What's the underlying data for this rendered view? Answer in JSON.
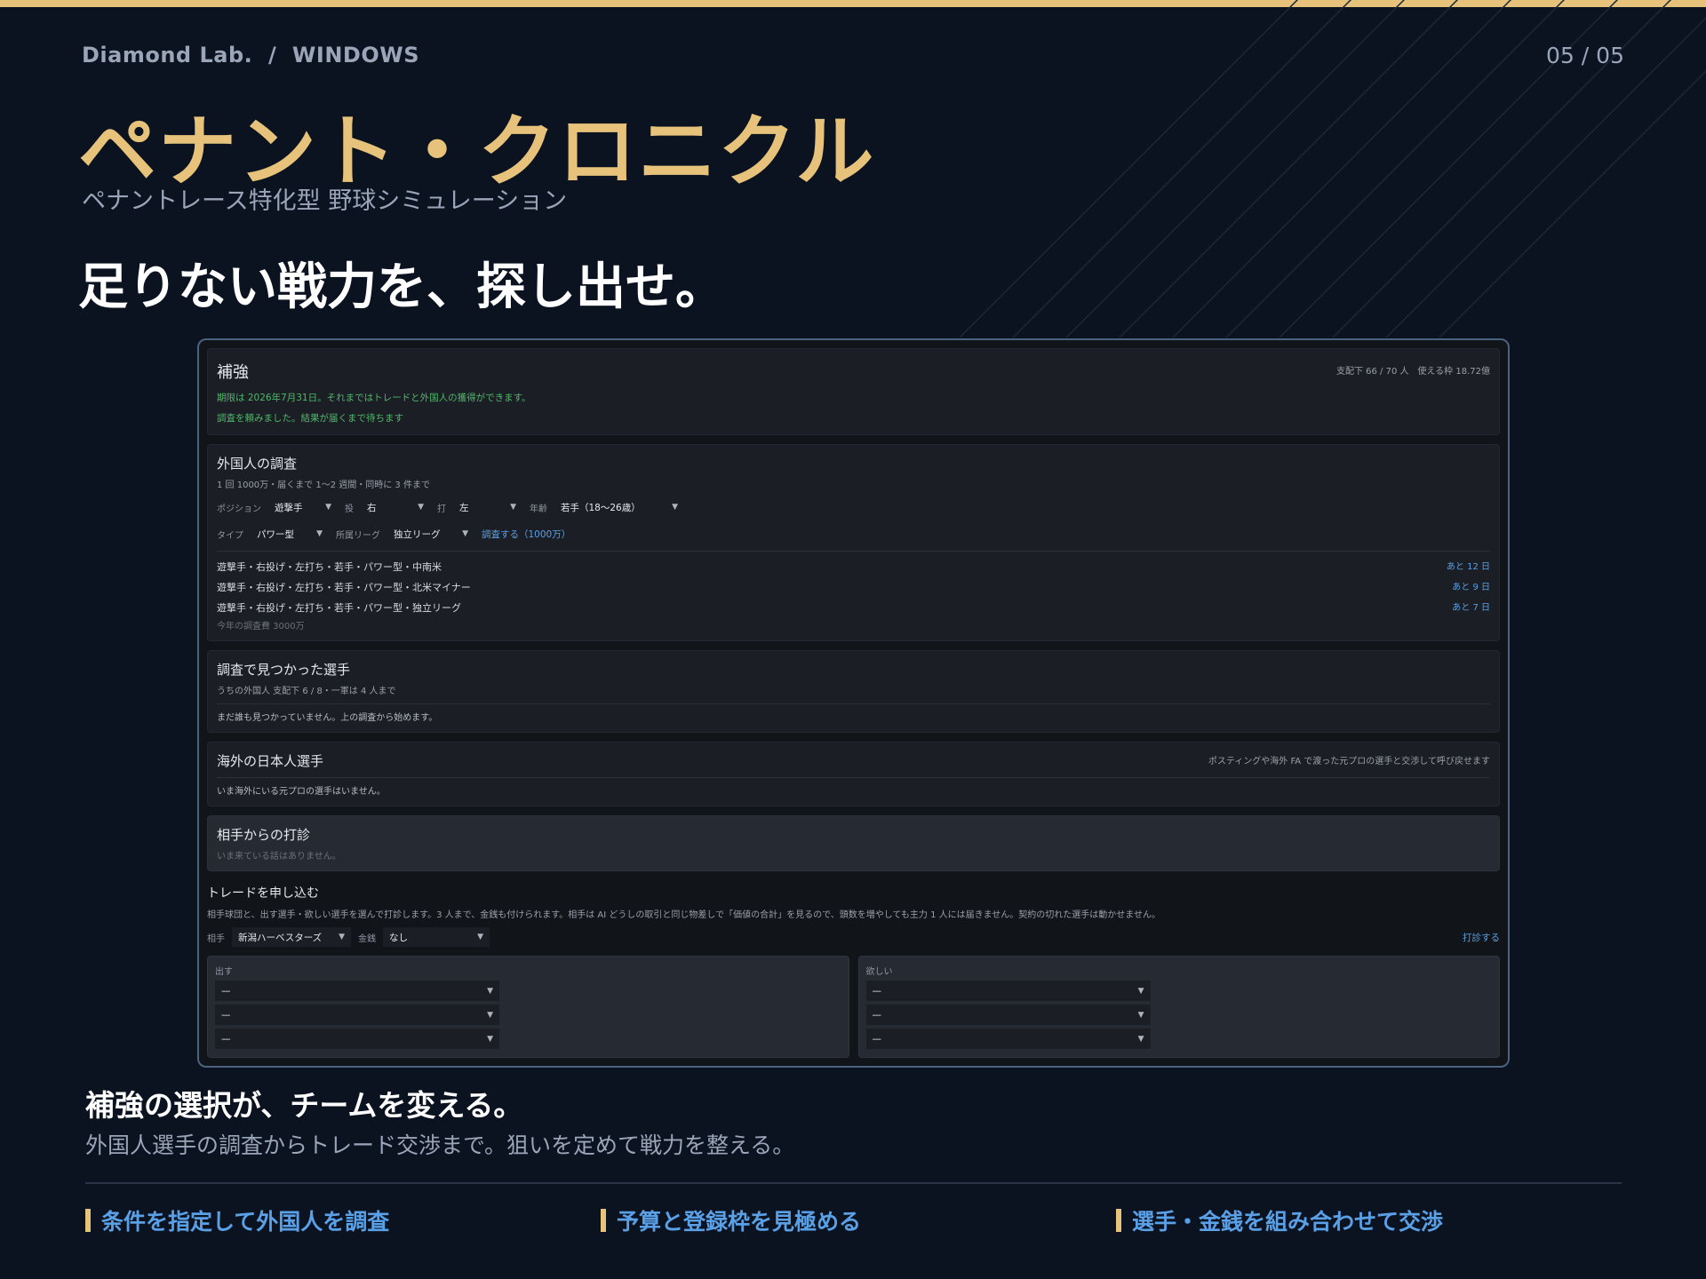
{
  "header": {
    "brand": "Diamond Lab.  /  WINDOWS",
    "page_num": "05 / 05",
    "title": "ペナント・クロニクル",
    "subtitle": "ペナントレース特化型 野球シミュレーション",
    "headline": "足りない戦力を、探し出せ。"
  },
  "screen": {
    "reinforce": {
      "title": "補強",
      "meta": "支配下 66 / 70 人　使える枠 18.72億",
      "deadline": "期限は 2026年7月31日。それまではトレードと外国人の獲得ができます。",
      "status": "調査を頼みました。結果が届くまで待ちます"
    },
    "scout": {
      "title": "外国人の調査",
      "info": "1 回 1000万・届くまで 1〜2 週間・同時に 3 件まで",
      "position_label": "ポジション",
      "position_value": "遊撃手",
      "throw_label": "投",
      "throw_value": "右",
      "bat_label": "打",
      "bat_value": "左",
      "age_label": "年齢",
      "age_value": "若手（18〜26歳）",
      "type_label": "タイプ",
      "type_value": "パワー型",
      "league_label": "所属リーグ",
      "league_value": "独立リーグ",
      "request_link": "調査する（1000万）",
      "requests": [
        {
          "text": "遊撃手・右投げ・左打ち・若手・パワー型・中南米",
          "eta": "あと 12 日"
        },
        {
          "text": "遊撃手・右投げ・左打ち・若手・パワー型・北米マイナー",
          "eta": "あと 9 日"
        },
        {
          "text": "遊撃手・右投げ・左打ち・若手・パワー型・独立リーグ",
          "eta": "あと 7 日"
        }
      ],
      "yearly_cost": "今年の調査費 3000万"
    },
    "found": {
      "title": "調査で見つかった選手",
      "info": "うちの外国人 支配下 6 / 8・一軍は 4 人まで",
      "empty": "まだ誰も見つかっていません。上の調査から始めます。"
    },
    "overseas": {
      "title": "海外の日本人選手",
      "note": "ポスティングや海外 FA で渡った元プロの選手と交渉して呼び戻せます",
      "empty": "いま海外にいる元プロの選手はいません。"
    },
    "offers": {
      "title": "相手からの打診",
      "empty": "いま来ている話はありません。"
    },
    "trade": {
      "title": "トレードを申し込む",
      "desc": "相手球団と、出す選手・欲しい選手を選んで打診します。3 人まで、金銭も付けられます。相手は AI どうしの取引と同じ物差しで「価値の合計」を見るので、頭数を増やしても主力 1 人には届きません。契約の切れた選手は動かせません。",
      "partner_label": "相手",
      "partner_value": "新潟ハーベスターズ",
      "money_label": "金銭",
      "money_value": "なし",
      "submit": "打診する",
      "give_label": "出す",
      "want_label": "欲しい",
      "empty_option": "—"
    }
  },
  "section": {
    "heading": "補強の選択が、チームを変える。",
    "desc": "外国人選手の調査からトレード交渉まで。狙いを定めて戦力を整える。"
  },
  "features": [
    "条件を指定して外国人を調査",
    "予算と登録枠を見極める",
    "選手・金銭を組み合わせて交渉"
  ],
  "colors": {
    "accent": "#e7c27a",
    "link": "#5aa0e6",
    "background": "#0b1220",
    "ok": "#4fb86a"
  }
}
